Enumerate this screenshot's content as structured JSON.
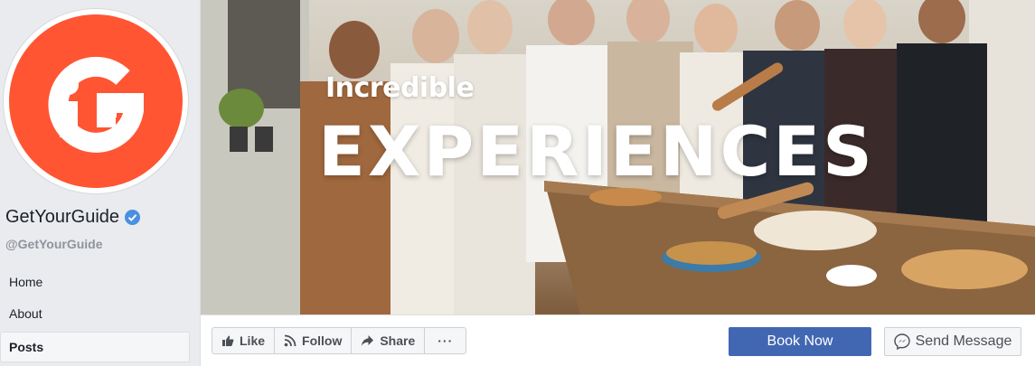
{
  "profile": {
    "name": "GetYourGuide",
    "handle": "@GetYourGuide",
    "logo_icon": "getyourguide-logo",
    "brand_color": "#ff5533",
    "verified": true
  },
  "nav": {
    "items": [
      {
        "label": "Home",
        "active": false
      },
      {
        "label": "About",
        "active": false
      },
      {
        "label": "Posts",
        "active": true
      }
    ]
  },
  "cover": {
    "headline_small": "Incredible",
    "headline_big": "EXPERIENCES"
  },
  "actions": {
    "like_label": "Like",
    "follow_label": "Follow",
    "share_label": "Share",
    "more_label": "···",
    "book_label": "Book Now",
    "message_label": "Send Message",
    "book_color": "#4267b2"
  }
}
